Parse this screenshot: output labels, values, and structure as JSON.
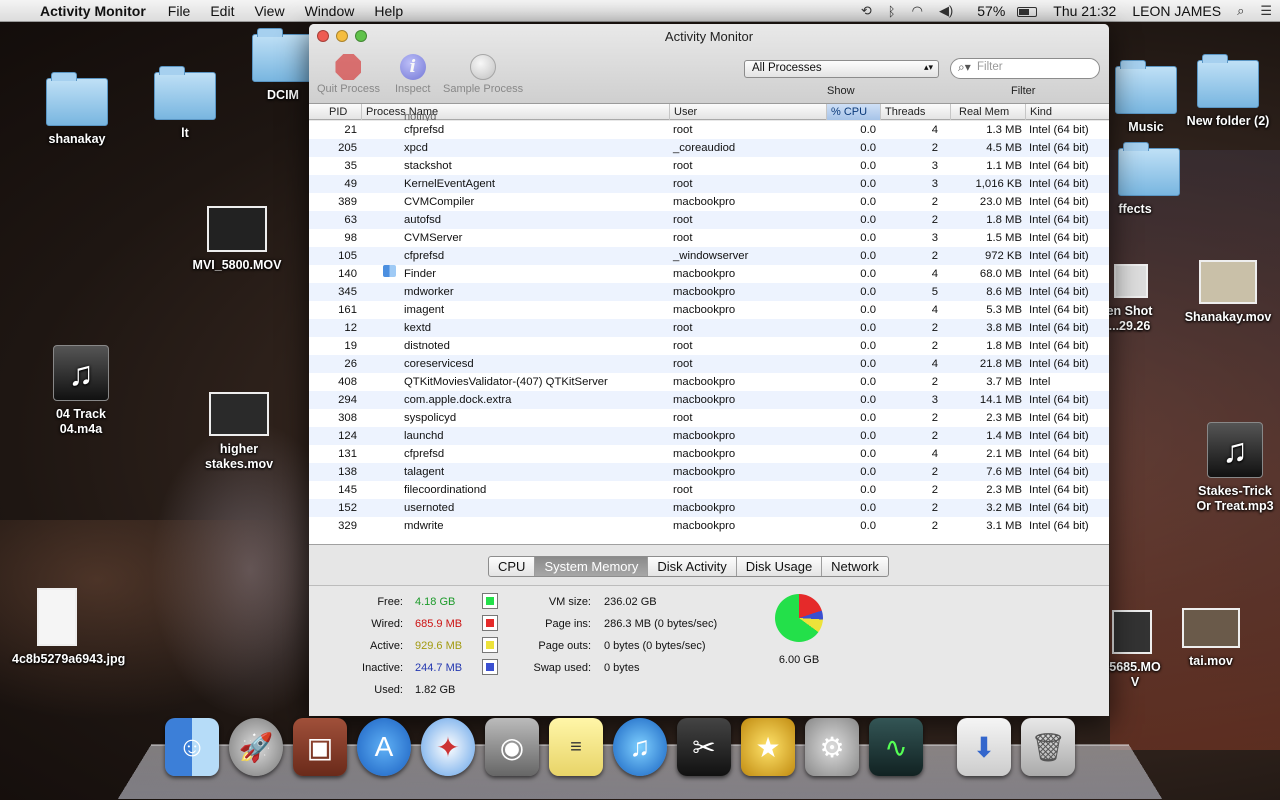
{
  "menubar": {
    "app": "Activity Monitor",
    "items": [
      "File",
      "Edit",
      "View",
      "Window",
      "Help"
    ],
    "battery": "57%",
    "clock": "Thu 21:32",
    "user": "LEON JAMES"
  },
  "desktop": {
    "shanakay": "shanakay",
    "lt": "lt",
    "dcim": "DCIM",
    "mvi": "MVI_5800.MOV",
    "track": "04 Track 04.m4a",
    "higher": "higher stakes.mov",
    "jpg": "4c8b5279a6943.jpg",
    "music": "Music",
    "newfolder": "New folder (2)",
    "effects": "ffects",
    "screenshot1": "en Shot",
    "screenshot2": "...29.26",
    "shanakaymov": "Shanakay.mov",
    "stakes": "Stakes-Trick Or Treat.mp3",
    "partialmov1": "5685.MO",
    "partialmov2": "V",
    "taimov": "tai.mov"
  },
  "window": {
    "title": "Activity Monitor",
    "toolbar": {
      "quit": "Quit Process",
      "inspect": "Inspect",
      "sample": "Sample Process",
      "show_label": "Show",
      "show_value": "All Processes",
      "filter_label": "Filter",
      "filter_placeholder": "Filter"
    },
    "columns": {
      "pid": "PID",
      "name": "Process Name",
      "user": "User",
      "cpu": "% CPU",
      "threads": "Threads",
      "mem": "Real Mem",
      "kind": "Kind"
    },
    "partial_row": "notifyd",
    "rows": [
      {
        "pid": "21",
        "name": "cfprefsd",
        "user": "root",
        "cpu": "0.0",
        "threads": "4",
        "mem": "1.3 MB",
        "kind": "Intel (64 bit)"
      },
      {
        "pid": "205",
        "name": "xpcd",
        "user": "_coreaudiod",
        "cpu": "0.0",
        "threads": "2",
        "mem": "4.5 MB",
        "kind": "Intel (64 bit)"
      },
      {
        "pid": "35",
        "name": "stackshot",
        "user": "root",
        "cpu": "0.0",
        "threads": "3",
        "mem": "1.1 MB",
        "kind": "Intel (64 bit)"
      },
      {
        "pid": "49",
        "name": "KernelEventAgent",
        "user": "root",
        "cpu": "0.0",
        "threads": "3",
        "mem": "1,016 KB",
        "kind": "Intel (64 bit)"
      },
      {
        "pid": "389",
        "name": "CVMCompiler",
        "user": "macbookpro",
        "cpu": "0.0",
        "threads": "2",
        "mem": "23.0 MB",
        "kind": "Intel (64 bit)"
      },
      {
        "pid": "63",
        "name": "autofsd",
        "user": "root",
        "cpu": "0.0",
        "threads": "2",
        "mem": "1.8 MB",
        "kind": "Intel (64 bit)"
      },
      {
        "pid": "98",
        "name": "CVMServer",
        "user": "root",
        "cpu": "0.0",
        "threads": "3",
        "mem": "1.5 MB",
        "kind": "Intel (64 bit)"
      },
      {
        "pid": "105",
        "name": "cfprefsd",
        "user": "_windowserver",
        "cpu": "0.0",
        "threads": "2",
        "mem": "972 KB",
        "kind": "Intel (64 bit)"
      },
      {
        "pid": "140",
        "name": "Finder",
        "user": "macbookpro",
        "cpu": "0.0",
        "threads": "4",
        "mem": "68.0 MB",
        "kind": "Intel (64 bit)"
      },
      {
        "pid": "345",
        "name": "mdworker",
        "user": "macbookpro",
        "cpu": "0.0",
        "threads": "5",
        "mem": "8.6 MB",
        "kind": "Intel (64 bit)"
      },
      {
        "pid": "161",
        "name": "imagent",
        "user": "macbookpro",
        "cpu": "0.0",
        "threads": "4",
        "mem": "5.3 MB",
        "kind": "Intel (64 bit)"
      },
      {
        "pid": "12",
        "name": "kextd",
        "user": "root",
        "cpu": "0.0",
        "threads": "2",
        "mem": "3.8 MB",
        "kind": "Intel (64 bit)"
      },
      {
        "pid": "19",
        "name": "distnoted",
        "user": "root",
        "cpu": "0.0",
        "threads": "2",
        "mem": "1.8 MB",
        "kind": "Intel (64 bit)"
      },
      {
        "pid": "26",
        "name": "coreservicesd",
        "user": "root",
        "cpu": "0.0",
        "threads": "4",
        "mem": "21.8 MB",
        "kind": "Intel (64 bit)"
      },
      {
        "pid": "408",
        "name": "QTKitMoviesValidator-(407) QTKitServer",
        "user": "macbookpro",
        "cpu": "0.0",
        "threads": "2",
        "mem": "3.7 MB",
        "kind": "Intel"
      },
      {
        "pid": "294",
        "name": "com.apple.dock.extra",
        "user": "macbookpro",
        "cpu": "0.0",
        "threads": "3",
        "mem": "14.1 MB",
        "kind": "Intel (64 bit)"
      },
      {
        "pid": "308",
        "name": "syspolicyd",
        "user": "root",
        "cpu": "0.0",
        "threads": "2",
        "mem": "2.3 MB",
        "kind": "Intel (64 bit)"
      },
      {
        "pid": "124",
        "name": "launchd",
        "user": "macbookpro",
        "cpu": "0.0",
        "threads": "2",
        "mem": "1.4 MB",
        "kind": "Intel (64 bit)"
      },
      {
        "pid": "131",
        "name": "cfprefsd",
        "user": "macbookpro",
        "cpu": "0.0",
        "threads": "4",
        "mem": "2.1 MB",
        "kind": "Intel (64 bit)"
      },
      {
        "pid": "138",
        "name": "talagent",
        "user": "macbookpro",
        "cpu": "0.0",
        "threads": "2",
        "mem": "7.6 MB",
        "kind": "Intel (64 bit)"
      },
      {
        "pid": "145",
        "name": "filecoordinationd",
        "user": "root",
        "cpu": "0.0",
        "threads": "2",
        "mem": "2.3 MB",
        "kind": "Intel (64 bit)"
      },
      {
        "pid": "152",
        "name": "usernoted",
        "user": "macbookpro",
        "cpu": "0.0",
        "threads": "2",
        "mem": "3.2 MB",
        "kind": "Intel (64 bit)"
      },
      {
        "pid": "329",
        "name": "mdwrite",
        "user": "macbookpro",
        "cpu": "0.0",
        "threads": "2",
        "mem": "3.1 MB",
        "kind": "Intel (64 bit)"
      }
    ],
    "tabs": [
      "CPU",
      "System Memory",
      "Disk Activity",
      "Disk Usage",
      "Network"
    ],
    "selected_tab": "System Memory",
    "memory": {
      "free_label": "Free:",
      "free": "4.18 GB",
      "free_color": "#23e04a",
      "wired_label": "Wired:",
      "wired": "685.9 MB",
      "wired_color": "#e52a2a",
      "active_label": "Active:",
      "active": "929.6 MB",
      "active_color": "#ede23a",
      "inactive_label": "Inactive:",
      "inactive": "244.7 MB",
      "inactive_color": "#3a4fd0",
      "used_label": "Used:",
      "used": "1.82 GB",
      "vmsize_label": "VM size:",
      "vmsize": "236.02 GB",
      "pageins_label": "Page ins:",
      "pageins": "286.3 MB (0 bytes/sec)",
      "pageouts_label": "Page outs:",
      "pageouts": "0 bytes (0 bytes/sec)",
      "swap_label": "Swap used:",
      "swap": "0 bytes",
      "total": "6.00 GB"
    }
  },
  "dock": [
    "finder-icon",
    "launchpad-icon",
    "photo-booth-icon",
    "app-store-icon",
    "safari-icon",
    "facetime-icon",
    "stickies-icon",
    "itunes-icon",
    "final-cut-icon",
    "imovie-icon",
    "system-preferences-icon",
    "activity-monitor-icon",
    "downloads-stack-icon",
    "trash-icon"
  ]
}
